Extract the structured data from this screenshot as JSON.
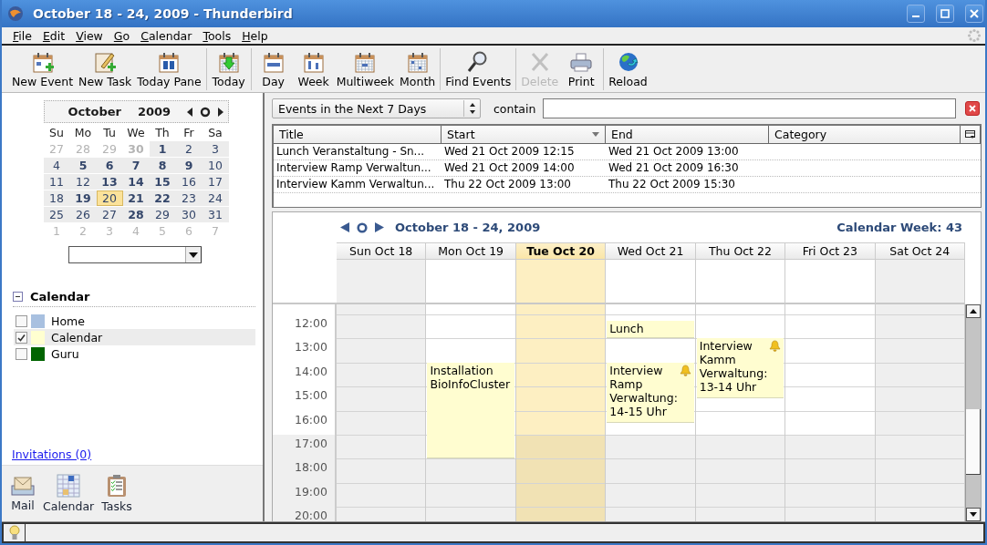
{
  "window": {
    "title": "October 18 - 24, 2009 - Thunderbird"
  },
  "menu": [
    "File",
    "Edit",
    "View",
    "Go",
    "Calendar",
    "Tools",
    "Help"
  ],
  "toolbar": [
    [
      {
        "label": "New Event",
        "disabled": false
      },
      {
        "label": "New Task",
        "disabled": false
      },
      {
        "label": "Today Pane",
        "disabled": false
      }
    ],
    [
      {
        "label": "Today",
        "disabled": false
      }
    ],
    [
      {
        "label": "Day",
        "disabled": false
      },
      {
        "label": "Week",
        "disabled": false
      },
      {
        "label": "Multiweek",
        "disabled": false
      },
      {
        "label": "Month",
        "disabled": false
      }
    ],
    [
      {
        "label": "Find Events",
        "disabled": false
      }
    ],
    [
      {
        "label": "Delete",
        "disabled": true
      },
      {
        "label": "Print",
        "disabled": false
      }
    ],
    [
      {
        "label": "Reload",
        "disabled": false
      }
    ]
  ],
  "mini_calendar": {
    "month": "October",
    "year": "2009",
    "weekdays": [
      "Su",
      "Mo",
      "Tu",
      "We",
      "Th",
      "Fr",
      "Sa"
    ],
    "weeks": [
      [
        {
          "day": "27",
          "other_month": true,
          "has_events": false,
          "selected": false
        },
        {
          "day": "28",
          "other_month": true,
          "has_events": false,
          "selected": false
        },
        {
          "day": "29",
          "other_month": true,
          "has_events": false,
          "selected": false
        },
        {
          "day": "30",
          "other_month": true,
          "has_events": true,
          "selected": false
        },
        {
          "day": "1",
          "other_month": false,
          "has_events": true,
          "selected": false
        },
        {
          "day": "2",
          "other_month": false,
          "has_events": false,
          "selected": false
        },
        {
          "day": "3",
          "other_month": false,
          "has_events": false,
          "selected": false
        }
      ],
      [
        {
          "day": "4",
          "other_month": false,
          "has_events": false,
          "selected": false
        },
        {
          "day": "5",
          "other_month": false,
          "has_events": true,
          "selected": false
        },
        {
          "day": "6",
          "other_month": false,
          "has_events": true,
          "selected": false
        },
        {
          "day": "7",
          "other_month": false,
          "has_events": true,
          "selected": false
        },
        {
          "day": "8",
          "other_month": false,
          "has_events": true,
          "selected": false
        },
        {
          "day": "9",
          "other_month": false,
          "has_events": true,
          "selected": false
        },
        {
          "day": "10",
          "other_month": false,
          "has_events": false,
          "selected": false
        }
      ],
      [
        {
          "day": "11",
          "other_month": false,
          "has_events": false,
          "selected": false
        },
        {
          "day": "12",
          "other_month": false,
          "has_events": false,
          "selected": false
        },
        {
          "day": "13",
          "other_month": false,
          "has_events": true,
          "selected": false
        },
        {
          "day": "14",
          "other_month": false,
          "has_events": true,
          "selected": false
        },
        {
          "day": "15",
          "other_month": false,
          "has_events": true,
          "selected": false
        },
        {
          "day": "16",
          "other_month": false,
          "has_events": false,
          "selected": false
        },
        {
          "day": "17",
          "other_month": false,
          "has_events": false,
          "selected": false
        }
      ],
      [
        {
          "day": "18",
          "other_month": false,
          "has_events": false,
          "selected": false
        },
        {
          "day": "19",
          "other_month": false,
          "has_events": true,
          "selected": false
        },
        {
          "day": "20",
          "other_month": false,
          "has_events": false,
          "selected": true
        },
        {
          "day": "21",
          "other_month": false,
          "has_events": true,
          "selected": false
        },
        {
          "day": "22",
          "other_month": false,
          "has_events": true,
          "selected": false
        },
        {
          "day": "23",
          "other_month": false,
          "has_events": false,
          "selected": false
        },
        {
          "day": "24",
          "other_month": false,
          "has_events": false,
          "selected": false
        }
      ],
      [
        {
          "day": "25",
          "other_month": false,
          "has_events": false,
          "selected": false
        },
        {
          "day": "26",
          "other_month": false,
          "has_events": false,
          "selected": false
        },
        {
          "day": "27",
          "other_month": false,
          "has_events": false,
          "selected": false
        },
        {
          "day": "28",
          "other_month": false,
          "has_events": true,
          "selected": false
        },
        {
          "day": "29",
          "other_month": false,
          "has_events": false,
          "selected": false
        },
        {
          "day": "30",
          "other_month": false,
          "has_events": false,
          "selected": false
        },
        {
          "day": "31",
          "other_month": false,
          "has_events": false,
          "selected": false
        }
      ],
      [
        {
          "day": "1",
          "other_month": true,
          "has_events": false,
          "selected": false
        },
        {
          "day": "2",
          "other_month": true,
          "has_events": false,
          "selected": false
        },
        {
          "day": "3",
          "other_month": true,
          "has_events": false,
          "selected": false
        },
        {
          "day": "4",
          "other_month": true,
          "has_events": false,
          "selected": false
        },
        {
          "day": "5",
          "other_month": true,
          "has_events": false,
          "selected": false
        },
        {
          "day": "6",
          "other_month": true,
          "has_events": false,
          "selected": false
        },
        {
          "day": "7",
          "other_month": true,
          "has_events": false,
          "selected": false
        }
      ]
    ]
  },
  "calendar_section": {
    "title": "Calendar",
    "expanded": true,
    "calendars": [
      {
        "name": "Home",
        "checked": false,
        "selected": false,
        "color": "#a8c0e0"
      },
      {
        "name": "Calendar",
        "checked": true,
        "selected": true,
        "color": "#ffffd0"
      },
      {
        "name": "Guru",
        "checked": false,
        "selected": false,
        "color": "#006400"
      }
    ]
  },
  "invitations": "Invitations (0)",
  "mode_tabs": [
    "Mail",
    "Calendar",
    "Tasks"
  ],
  "filter": {
    "value": "Events in the Next 7 Days",
    "contain_label": "contain"
  },
  "event_list": {
    "columns": [
      {
        "label": "Title",
        "sorted": false
      },
      {
        "label": "Start",
        "sorted": true
      },
      {
        "label": "End",
        "sorted": false
      },
      {
        "label": "Category",
        "sorted": false
      }
    ],
    "rows": [
      [
        "Lunch Veranstaltung - Sn...",
        "Wed 21 Oct 2009 12:15",
        "Wed 21 Oct 2009 13:00"
      ],
      [
        "Interview Ramp Verwaltun...",
        "Wed 21 Oct 2009 14:00",
        "Wed 21 Oct 2009 16:30"
      ],
      [
        "Interview Kamm Verwaltun...",
        "Thu 22 Oct 2009 13:00",
        "Thu 22 Oct 2009 15:30"
      ]
    ]
  },
  "week_view": {
    "title": "October 18 - 24, 2009",
    "week_label": "Calendar Week: 43",
    "days": [
      {
        "label": "Sun Oct 18",
        "today": false,
        "weekend": true
      },
      {
        "label": "Mon Oct 19",
        "today": false,
        "weekend": false,
        "events": [
          {
            "title": "Installation BioInfoCluster",
            "alarm": false
          }
        ]
      },
      {
        "label": "Tue Oct 20",
        "today": true,
        "weekend": false
      },
      {
        "label": "Wed Oct 21",
        "today": false,
        "weekend": false,
        "events": [
          {
            "title": "Lunch",
            "alarm": false
          },
          {
            "title": "Interview Ramp Verwaltung: 14-15 Uhr",
            "alarm": true
          }
        ]
      },
      {
        "label": "Thu Oct 22",
        "today": false,
        "weekend": false,
        "events": [
          {
            "title": "Interview Kamm Verwaltung: 13-14 Uhr",
            "alarm": true
          }
        ]
      },
      {
        "label": "Fri Oct 23",
        "today": false,
        "weekend": false
      },
      {
        "label": "Sat Oct 24",
        "today": false,
        "weekend": true
      }
    ],
    "hours": [
      {
        "label": "12:00",
        "off_hours": false
      },
      {
        "label": "13:00",
        "off_hours": false
      },
      {
        "label": "14:00",
        "off_hours": false
      },
      {
        "label": "15:00",
        "off_hours": false
      },
      {
        "label": "16:00",
        "off_hours": false
      },
      {
        "label": "17:00",
        "off_hours": true
      },
      {
        "label": "18:00",
        "off_hours": true
      },
      {
        "label": "19:00",
        "off_hours": true
      },
      {
        "label": "20:00",
        "off_hours": true
      }
    ]
  }
}
